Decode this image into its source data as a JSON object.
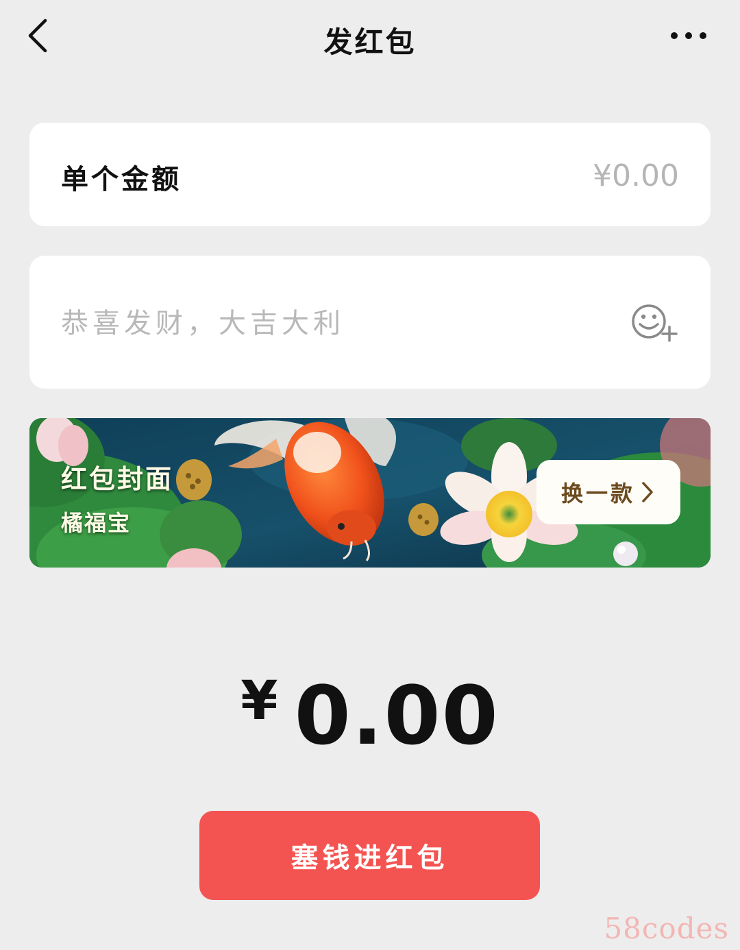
{
  "nav": {
    "title": "发红包",
    "back_icon": "chevron-left-icon",
    "more_icon": "more-dots-icon"
  },
  "amount": {
    "label": "单个金额",
    "value": "",
    "placeholder": "¥0.00"
  },
  "greeting": {
    "value": "",
    "placeholder": "恭喜发财，大吉大利",
    "emoji_icon": "emoji-add-icon"
  },
  "cover": {
    "title": "红包封面",
    "name": "橘福宝",
    "change_label": "换一款",
    "change_icon": "chevron-right-icon"
  },
  "total": {
    "currency": "¥",
    "value": "0.00"
  },
  "submit": {
    "label": "塞钱进红包",
    "color": "#f45451"
  },
  "watermark": {
    "text": "58codes"
  }
}
